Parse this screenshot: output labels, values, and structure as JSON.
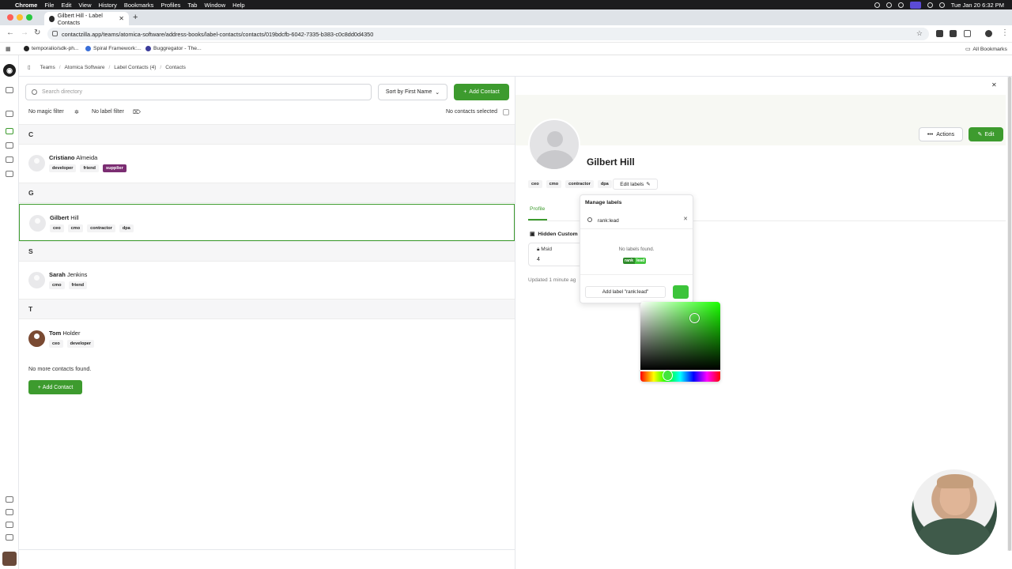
{
  "menubar": {
    "app": "Chrome",
    "items": [
      "File",
      "Edit",
      "View",
      "History",
      "Bookmarks",
      "Profiles",
      "Tab",
      "Window",
      "Help"
    ],
    "clock": "Tue Jan 20  6:32 PM"
  },
  "browser": {
    "tab_title": "Gilbert Hill - Label Contacts",
    "url": "contactzilla.app/teams/atomica-software/address-books/label-contacts/contacts/019bdcfb-6042-7335-b383-c0c8dd0d4350",
    "bookmarks": [
      "temporalio/sdk-ph...",
      "Spiral Framework:...",
      "Buggregator - The..."
    ],
    "all_bookmarks": "All Bookmarks"
  },
  "breadcrumb": [
    "Teams",
    "Atomica Software",
    "Label Contacts (4)",
    "Contacts"
  ],
  "list": {
    "search_placeholder": "Search directory",
    "sort_label": "Sort by First Name",
    "add_contact": "Add Contact",
    "magic_filter": "No magic filter",
    "label_filter": "No label filter",
    "selection": "No contacts selected",
    "groups": [
      {
        "letter": "C",
        "contacts": [
          {
            "first": "Cristiano",
            "last": "Almeida",
            "tags": [
              "developer",
              "friend",
              "supplier"
            ]
          }
        ]
      },
      {
        "letter": "G",
        "contacts": [
          {
            "first": "Gilbert",
            "last": "Hill",
            "tags": [
              "ceo",
              "cmo",
              "contractor",
              "dpa"
            ]
          }
        ]
      },
      {
        "letter": "S",
        "contacts": [
          {
            "first": "Sarah",
            "last": "Jenkins",
            "tags": [
              "cmo",
              "friend"
            ]
          }
        ]
      },
      {
        "letter": "T",
        "contacts": [
          {
            "first": "Tom",
            "last": "Holder",
            "tags": [
              "ceo",
              "developer"
            ]
          }
        ]
      }
    ],
    "no_more": "No more contacts found.",
    "add_contact_bottom": "Add Contact"
  },
  "detail": {
    "name": "Gilbert Hill",
    "actions": "Actions",
    "edit": "Edit",
    "tags": [
      "ceo",
      "cmo",
      "contractor",
      "dpa"
    ],
    "edit_labels": "Edit labels",
    "tab_profile": "Profile",
    "hidden_custom": "Hidden Custom",
    "msid_label": "Msid",
    "msid_value": "4",
    "updated": "Updated 1 minute ag"
  },
  "popover": {
    "title": "Manage labels",
    "query": "rank:lead",
    "no_labels": "No labels found.",
    "preview_key": "rank",
    "preview_value": "lead",
    "add_label": "Add label \"rank:lead\"",
    "color": "#3cc43a"
  },
  "colors": {
    "accent": "#3d9b2e",
    "supplier_tag": "#7b2d72",
    "preview_dark": "#2e8b2a",
    "preview_light": "#44c43f"
  }
}
